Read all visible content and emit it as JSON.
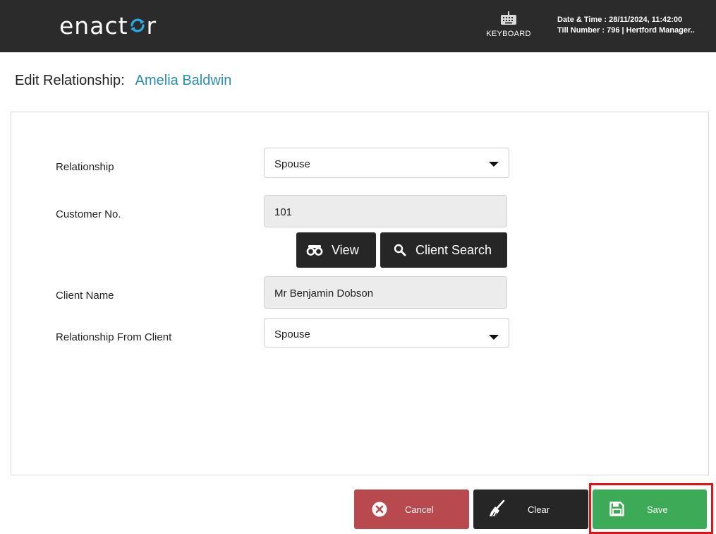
{
  "header": {
    "logo_text_before": "enact",
    "logo_text_after": "r",
    "keyboard_label": "KEYBOARD",
    "date_time": "Date & Time : 28/11/2024, 11:42:00",
    "till_info": "Till Number : 796  |  Hertford Manager.."
  },
  "page": {
    "title": "Edit Relationship:",
    "customer_name": "Amelia Baldwin"
  },
  "form": {
    "relationship_label": "Relationship",
    "relationship_value": "Spouse",
    "customer_no_label": "Customer No.",
    "customer_no_value": "101",
    "view_label": "View",
    "client_search_label": "Client Search",
    "client_name_label": "Client Name",
    "client_name_value": "Mr Benjamin Dobson",
    "relationship_from_client_label": "Relationship From Client",
    "relationship_from_client_value": "Spouse"
  },
  "footer": {
    "cancel_label": "Cancel",
    "clear_label": "Clear",
    "save_label": "Save"
  },
  "colors": {
    "header_bg": "#2b2b2b",
    "accent": "#2a8cb5",
    "logo_accent": "#29a9e0",
    "cancel": "#b84a4f",
    "clear": "#262626",
    "save": "#3daa58",
    "highlight": "#e81010"
  },
  "icons": {
    "keyboard": "keyboard-icon",
    "view": "binoculars-icon",
    "client_search": "search-icon",
    "cancel": "close-circle-icon",
    "clear": "broom-icon",
    "save": "floppy-disk-icon"
  }
}
